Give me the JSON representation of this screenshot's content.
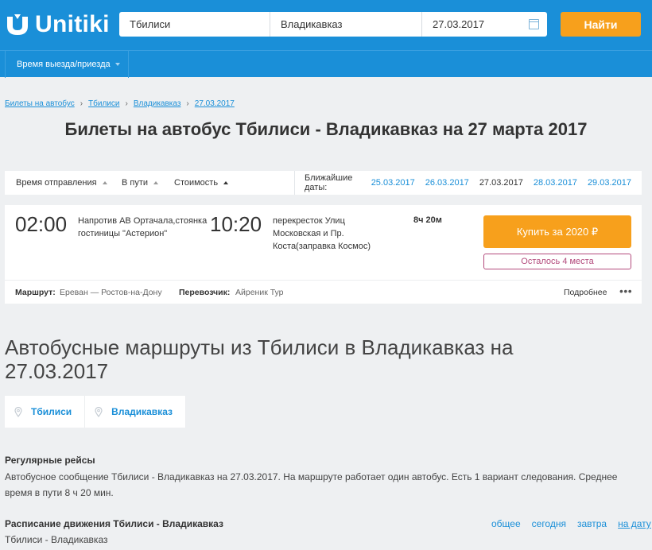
{
  "header": {
    "logo_text": "Unitiki",
    "from": "Тбилиси",
    "to": "Владикавказ",
    "date": "27.03.2017",
    "search_button": "Найти",
    "time_filter": "Время выезда/приезда",
    "brand_color": "#1a8fd8",
    "accent_color": "#f7a01c"
  },
  "breadcrumb": [
    "Билеты на автобус",
    "Тбилиси",
    "Владикавказ",
    "27.03.2017"
  ],
  "page_title": "Билеты на автобус Тбилиси - Владикавказ на 27 марта 2017",
  "sort": {
    "departure": "Время отправления",
    "travel": "В пути",
    "price": "Стоимость",
    "nearest_label": "Ближайшие даты:",
    "dates": [
      "25.03.2017",
      "26.03.2017",
      "27.03.2017",
      "28.03.2017",
      "29.03.2017"
    ],
    "current_date": "27.03.2017"
  },
  "trip": {
    "departure_time": "02:00",
    "departure_stop": "Напротив АВ Ортачала,стоянка гостиницы \"Астерион\"",
    "arrival_time": "10:20",
    "arrival_stop": "перекресток Улиц Московская и Пр. Коста(заправка Космос)",
    "duration": "8ч 20м",
    "buy_label": "Купить за 2020 ₽",
    "seats_left": "Осталось 4 места",
    "route_label": "Маршрут:",
    "route": "Ереван — Ростов-на-Дону",
    "carrier_label": "Перевозчик:",
    "carrier": "Айреник Тур",
    "more": "Подробнее",
    "dots": "•••"
  },
  "routes": {
    "title": "Автобусные маршруты из Тбилиси в Владикавказ на 27.03.2017",
    "cities": [
      "Тбилиси",
      "Владикавказ"
    ],
    "regular_title": "Регулярные рейсы",
    "regular_text": "Автобусное сообщение Тбилиси - Владикавказ на 27.03.2017. На маршруте работает один автобус. Есть 1 вариант следования. Среднее время в пути 8 ч 20 мин.",
    "schedule_title": "Расписание движения Тбилиси - Владикавказ",
    "schedule_links": [
      "общее",
      "сегодня",
      "завтра",
      "на дату"
    ],
    "schedule_sub": "Тбилиси - Владикавказ"
  }
}
